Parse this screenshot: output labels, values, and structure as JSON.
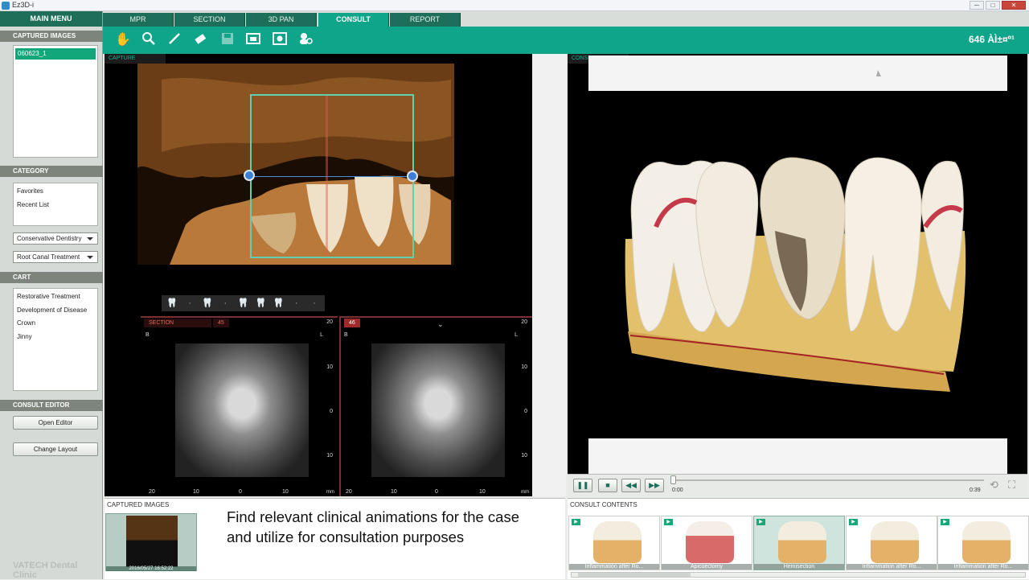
{
  "window": {
    "title": "Ez3D-i"
  },
  "left_panel": {
    "main_menu": "MAIN MENU",
    "captured_images": {
      "header": "CAPTURED IMAGES",
      "items": [
        "060623_1"
      ]
    },
    "category": {
      "header": "CATEGORY",
      "items": [
        "Favorites",
        "Recent List"
      ],
      "dropdowns": [
        "Conservative Dentistry",
        "Root Canal Treatment"
      ]
    },
    "cart": {
      "header": "CART",
      "items": [
        "Restorative Treatment",
        "Development of Disease",
        "Crown",
        "Jinny"
      ]
    },
    "consult_editor": {
      "header": "CONSULT EDITOR",
      "open_editor": "Open Editor",
      "change_layout": "Change Layout"
    },
    "watermark": "VATECH Dental Clinic"
  },
  "tabs": [
    "MPR",
    "SECTION",
    "3D PAN",
    "CONSULT",
    "REPORT"
  ],
  "active_tab": "CONSULT",
  "toolbar": {
    "tools": [
      "hand-icon",
      "zoom-icon",
      "pen-icon",
      "eraser-icon",
      "save-icon",
      "capture-icon",
      "screenshot-icon",
      "consult-icon"
    ],
    "page_indicator": "646 ÀÌ±¤º¹"
  },
  "capture_panel": {
    "label": "CAPTURE",
    "section_tag": "SECTION",
    "section_left_number": "45",
    "section_right_number": "46",
    "orientation": {
      "b": "B",
      "l": "L"
    },
    "y_ticks": [
      "20",
      "10",
      "0",
      "10"
    ],
    "x_ticks": [
      "20",
      "10",
      "0",
      "10"
    ],
    "unit": "mm"
  },
  "consult_panel": {
    "label": "CONSULT"
  },
  "player": {
    "time_start": "0:00",
    "time_end": "0:39"
  },
  "captured_strip": {
    "header": "CAPTURED IMAGES",
    "timestamp": "2016/05/27 16:52:22",
    "caption": "Find relevant clinical animations for the case and utilize for consultation purposes"
  },
  "consult_contents": {
    "header": "CONSULT CONTENTS",
    "items": [
      "Inflammation after Ro...",
      "Apicoectomy",
      "Hemisection",
      "Inflammation after Ro...",
      "Inflammation after Ro..."
    ]
  },
  "colors": {
    "primary": "#0fa58a",
    "dark": "#1d6e5b",
    "selected": "#12a77a"
  }
}
